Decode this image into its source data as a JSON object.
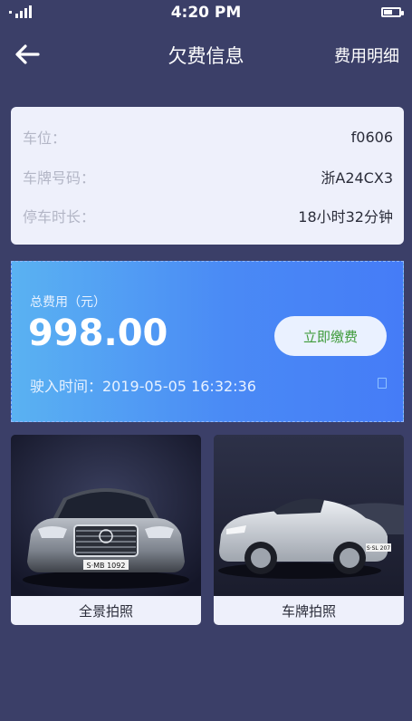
{
  "status_bar": {
    "time": "4:20 PM"
  },
  "nav": {
    "title": "欠费信息",
    "right_action": "费用明细"
  },
  "info": {
    "rows": [
      {
        "label": "车位：",
        "value": "f0606"
      },
      {
        "label": "车牌号码：",
        "value": "浙A24CX3"
      },
      {
        "label": "停车时长：",
        "value": "18小时32分钟"
      }
    ]
  },
  "fee": {
    "label": "总费用（元）",
    "amount": "998.00",
    "pay_button": "立即缴费",
    "entry_time": "驶入时间：2019-05-05   16:32:36"
  },
  "photos": [
    {
      "caption": "全景拍照",
      "plate_text": "S·MB 1092"
    },
    {
      "caption": "车牌拍照",
      "plate_text": "S·SL 207"
    }
  ],
  "colors": {
    "background": "#3b3f68",
    "card": "#eef0fb",
    "fee_gradient_start": "#5ab2f2",
    "fee_gradient_end": "#457cf7",
    "pay_button_text": "#3f9b3a"
  }
}
